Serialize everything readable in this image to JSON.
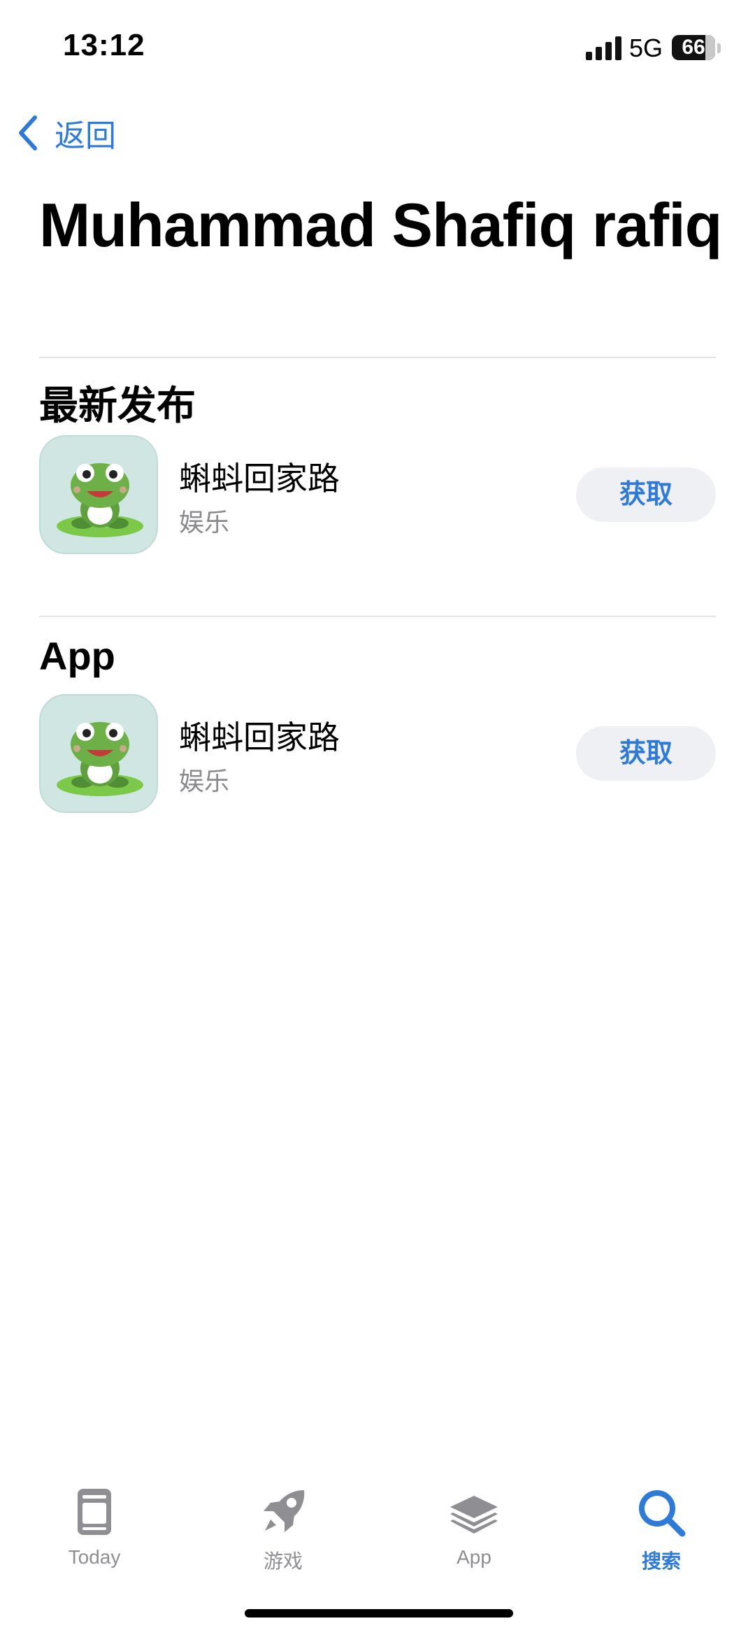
{
  "status_bar": {
    "time": "13:12",
    "network": "5G",
    "battery": "66"
  },
  "nav": {
    "back_label": "返回"
  },
  "page": {
    "title": "Muhammad Shafiq rafiq"
  },
  "sections": [
    {
      "title": "最新发布",
      "app": {
        "name": "蝌蚪回家路",
        "category": "娱乐",
        "button": "获取",
        "icon": "frog-app-icon"
      }
    },
    {
      "title": "App",
      "app": {
        "name": "蝌蚪回家路",
        "category": "娱乐",
        "button": "获取",
        "icon": "frog-app-icon"
      }
    }
  ],
  "tab_bar": {
    "tabs": [
      {
        "label": "Today",
        "icon": "today-icon",
        "active": false
      },
      {
        "label": "游戏",
        "icon": "rocket-icon",
        "active": false
      },
      {
        "label": "App",
        "icon": "layers-icon",
        "active": false
      },
      {
        "label": "搜索",
        "icon": "search-icon",
        "active": true
      }
    ]
  },
  "colors": {
    "accent": "#2f7ad6",
    "inactive": "#8e8e93",
    "divider": "#e3e3e6",
    "button_bg": "#eef0f3"
  }
}
